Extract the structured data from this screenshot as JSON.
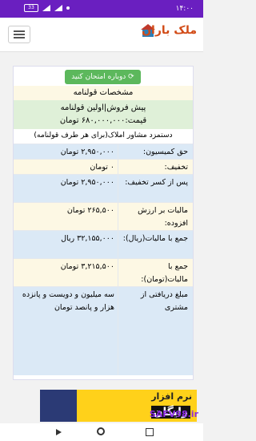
{
  "status": {
    "time": "۱۴:۰۰",
    "battery": "33"
  },
  "header": {
    "logo_text": "ملک باران"
  },
  "panel": {
    "retry_label": "دوباره امتحان کنید",
    "section_title": "مشخصات قولنامه",
    "title_line": "پیش فروش|اولین قولنامه",
    "price_line": "قیمت:۶۸۰,۰۰۰,۰۰۰ تومان",
    "note": "دستمزد مشاور املاک(برای هر طرف قولنامه)",
    "rows": [
      {
        "label": "حق کمیسیون:",
        "value": "۲,۹۵۰,۰۰۰ تومان"
      },
      {
        "label": "تخفیف:",
        "value": "۰ تومان"
      },
      {
        "label": "پس از کسر تخفیف:",
        "value": "۲,۹۵۰,۰۰۰ تومان"
      },
      {
        "label": "مالیات بر ارزش افزوده:",
        "value": "۲۶۵,۵۰۰ تومان"
      },
      {
        "label": "جمع با مالیات(ریال):",
        "value": "۳۲,۱۵۵,۰۰۰ ریال"
      },
      {
        "label": "جمع با مالیات(تومان):",
        "value": "۳,۲۱۵,۵۰۰ تومان"
      },
      {
        "label": "مبلغ دریافتی از مشتری",
        "value": "سه میلیون و دویست و پانزده هزار و پانصد تومان"
      }
    ]
  },
  "banner": {
    "line1": "نرم افزار",
    "line2": "رایگان"
  },
  "watermark": "SAFV98.ir"
}
